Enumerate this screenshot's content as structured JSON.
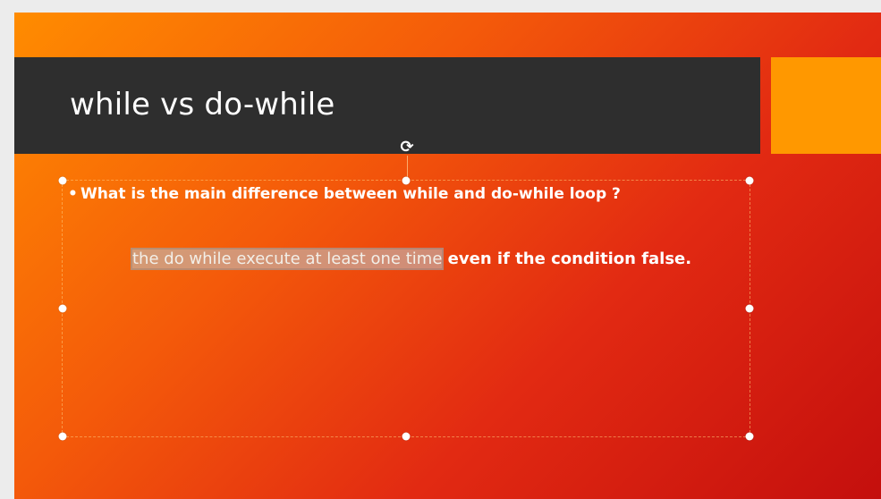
{
  "slide": {
    "title": "while vs do-while",
    "bullet": "What is the main difference between while and do-while loop ?",
    "answer_selected": "the do while execute at least one time",
    "answer_rest": " even if the condition false."
  },
  "icons": {
    "rotate": "rotate-handle-icon",
    "bullet": "bullet-dot-icon"
  },
  "colors": {
    "title_bar": "#2e2e2e",
    "accent": "#ff9800",
    "background_start": "#ff8c00",
    "background_end": "#c40f0d",
    "text": "#ffffff",
    "selection": "#bebebe"
  }
}
